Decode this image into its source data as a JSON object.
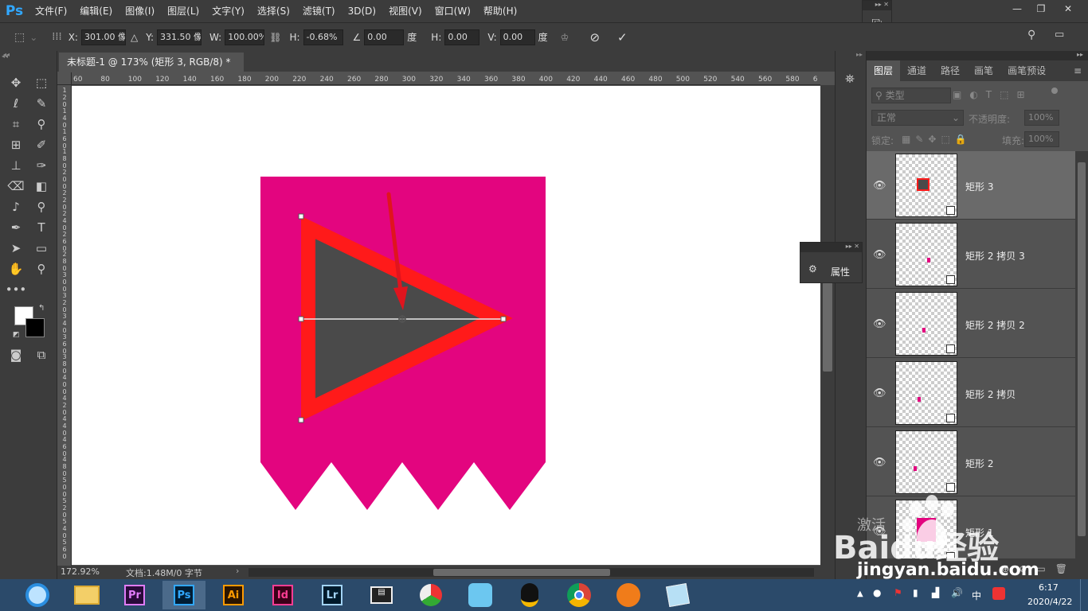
{
  "app": {
    "logo": "Ps"
  },
  "menu": [
    "文件(F)",
    "编辑(E)",
    "图像(I)",
    "图层(L)",
    "文字(Y)",
    "选择(S)",
    "滤镜(T)",
    "3D(D)",
    "视图(V)",
    "窗口(W)",
    "帮助(H)"
  ],
  "options": {
    "x_label": "X:",
    "x_value": "301.00 像素",
    "y_label": "Y:",
    "y_value": "331.50 像素",
    "w_label": "W:",
    "w_value": "100.00%",
    "h_label": "H:",
    "h_value": "-0.68%",
    "angle_value": "0.00",
    "angle_unit": "度",
    "hskew_label": "H:",
    "hskew_value": "0.00",
    "hskew_unit": "度",
    "vskew_label": "V:",
    "vskew_value": "0.00",
    "vskew_unit": "度"
  },
  "document": {
    "tab_title": "未标题-1 @ 173% (矩形 3, RGB/8) *",
    "close": "×"
  },
  "ruler": {
    "h_ticks": [
      "60",
      "80",
      "100",
      "120",
      "140",
      "160",
      "180",
      "200",
      "220",
      "240",
      "260",
      "280",
      "300",
      "320",
      "340",
      "360",
      "380",
      "400",
      "420",
      "440",
      "460",
      "480",
      "500",
      "520",
      "540",
      "560",
      "580",
      "6"
    ],
    "v_ticks": [
      "1 2 0",
      "1 4 0",
      "1 6 0",
      "1 8 0",
      "2 0 0",
      "2 2 0",
      "2 4 0",
      "2 6 0",
      "2 8 0",
      "3 0 0",
      "3 2 0",
      "3 4 0",
      "3 6 0",
      "3 8 0",
      "4 0 0",
      "4 2 0",
      "4 4 0",
      "4 6 0",
      "4 8 0",
      "5 0 0",
      "5 2 0",
      "5 4 0",
      "5 6 0"
    ]
  },
  "status": {
    "zoom": "172.92%",
    "doc_info": "文档:1.48M/0 字节"
  },
  "colors": {
    "banner": "#e3057f",
    "triangle_stroke": "#ff1a1a",
    "triangle_fill": "#4a4a4a",
    "arrow": "#e0141e",
    "ps_blue": "#31a8ff"
  },
  "layers_panel": {
    "tabs": [
      "图层",
      "通道",
      "路径",
      "画笔",
      "画笔预设"
    ],
    "filter_kind": "类型",
    "blend_mode": "正常",
    "opacity_label": "不透明度:",
    "opacity_value": "100%",
    "lock_label": "锁定:",
    "fill_label": "填充:",
    "fill_value": "100%",
    "layers": [
      {
        "name": "矩形 3"
      },
      {
        "name": "矩形 2 拷贝 3"
      },
      {
        "name": "矩形 2 拷贝 2"
      },
      {
        "name": "矩形 2 拷贝"
      },
      {
        "name": "矩形 2"
      },
      {
        "name": "矩形 1"
      }
    ]
  },
  "properties_panel": {
    "label": "属性"
  },
  "watermark": {
    "brand": "Baidu经验",
    "url": "jingyan.baidu.com",
    "activate_text": "激活"
  },
  "taskbar": {
    "apps": [
      {
        "name": "Pr"
      },
      {
        "name": "Ps"
      },
      {
        "name": "Ai"
      },
      {
        "name": "Id"
      },
      {
        "name": "Lr"
      }
    ],
    "time": "6:17",
    "date": "2020/4/22",
    "ime": "中"
  }
}
